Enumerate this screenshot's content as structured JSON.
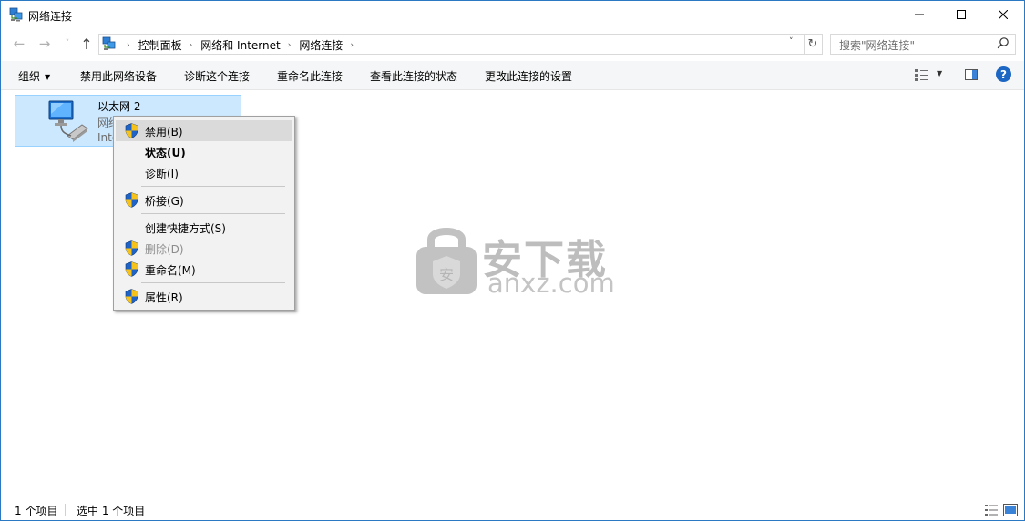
{
  "window": {
    "title": "网络连接",
    "controls": {
      "minimize": "—",
      "maximize": "☐",
      "close": "✕"
    }
  },
  "nav": {
    "back_icon": "←",
    "forward_icon": "→",
    "recent_icon": "˅",
    "up_icon": "↑",
    "breadcrumbs": [
      "控制面板",
      "网络和 Internet",
      "网络连接"
    ],
    "crumb_separator": "›",
    "dropdown_icon": "˅",
    "refresh_icon": "↻",
    "search_placeholder": "搜索\"网络连接\""
  },
  "toolbar": {
    "organize_label": "组织",
    "organize_caret": "▼",
    "commands": [
      "禁用此网络设备",
      "诊断这个连接",
      "重命名此连接",
      "查看此连接的状态",
      "更改此连接的设置"
    ],
    "view_caret": "▼",
    "help_label": "?"
  },
  "items": [
    {
      "name": "以太网 2",
      "line2": "网络",
      "line3": "Inte",
      "selected": true
    }
  ],
  "context_menu": {
    "items": [
      {
        "label": "禁用(B)",
        "icon": "shield-icon",
        "highlighted": true
      },
      {
        "label": "状态(U)",
        "bold": true
      },
      {
        "label": "诊断(I)"
      },
      {
        "label": "桥接(G)",
        "icon": "shield-icon"
      },
      {
        "label": "创建快捷方式(S)"
      },
      {
        "label": "删除(D)",
        "icon": "shield-icon",
        "disabled": true
      },
      {
        "label": "重命名(M)",
        "icon": "shield-icon"
      },
      {
        "label": "属性(R)",
        "icon": "shield-icon"
      }
    ]
  },
  "watermark": {
    "cn": "安下载",
    "en": "anxz.com",
    "lock_char": "安"
  },
  "status": {
    "count": "1 个项目",
    "selected": "选中 1 个项目"
  },
  "colors": {
    "accent": "#1c67c3",
    "selection_bg": "#cce8ff",
    "selection_border": "#99d1ff",
    "menu_bg": "#f2f2f2",
    "menu_highlight": "#dadada"
  }
}
